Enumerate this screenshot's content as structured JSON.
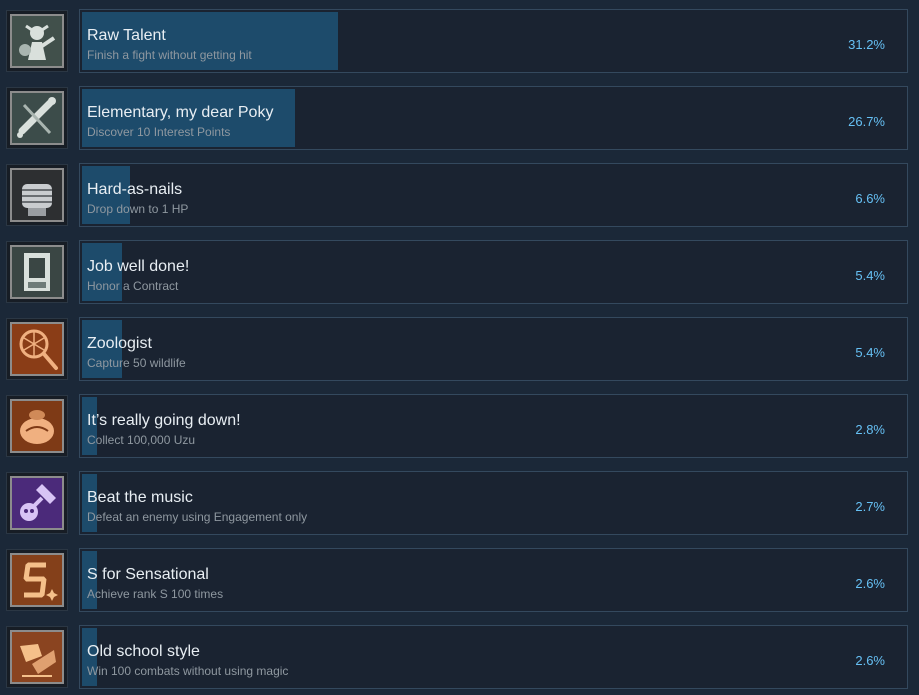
{
  "achievements": [
    {
      "name": "Raw Talent",
      "description": "Finish a fight without getting hit",
      "percent": "31.2%",
      "percent_value": 31.2,
      "icon": "fighter-icon",
      "colors": {
        "bg": "#41504b",
        "fg": "#d9e0dc"
      }
    },
    {
      "name": "Elementary, my dear Poky",
      "description": "Discover 10 Interest Points",
      "percent": "26.7%",
      "percent_value": 26.7,
      "icon": "telescope-icon",
      "colors": {
        "bg": "#3c4c4a",
        "fg": "#d9e0dc"
      }
    },
    {
      "name": "Hard-as-nails",
      "description": "Drop down to 1 HP",
      "percent": "6.6%",
      "percent_value": 6.6,
      "icon": "bandaged-fist-icon",
      "colors": {
        "bg": "#2d2f31",
        "fg": "#c9cccf"
      }
    },
    {
      "name": "Job well done!",
      "description": "Honor a Contract",
      "percent": "5.4%",
      "percent_value": 5.4,
      "icon": "contract-icon",
      "colors": {
        "bg": "#3a4644",
        "fg": "#d9e0dc"
      }
    },
    {
      "name": "Zoologist",
      "description": "Capture 50 wildlife",
      "percent": "5.4%",
      "percent_value": 5.4,
      "icon": "net-icon",
      "colors": {
        "bg": "#8a3d17",
        "fg": "#f0b080"
      }
    },
    {
      "name": "It’s really going down!",
      "description": "Collect 100,000 Uzu",
      "percent": "2.8%",
      "percent_value": 2.8,
      "icon": "money-bag-icon",
      "colors": {
        "bg": "#7e3a16",
        "fg": "#f0b080"
      }
    },
    {
      "name": "Beat the music",
      "description": "Defeat an enemy using Engagement only",
      "percent": "2.7%",
      "percent_value": 2.7,
      "icon": "hammer-skull-icon",
      "colors": {
        "bg": "#4b2a7a",
        "fg": "#d8c4f5"
      }
    },
    {
      "name": "S for Sensational",
      "description": "Achieve rank S 100 times",
      "percent": "2.6%",
      "percent_value": 2.6,
      "icon": "rank-s-icon",
      "colors": {
        "bg": "#84401a",
        "fg": "#f5c08a"
      }
    },
    {
      "name": "Old school style",
      "description": "Win 100 combats without using magic",
      "percent": "2.6%",
      "percent_value": 2.6,
      "icon": "fist-icon",
      "colors": {
        "bg": "#8a4420",
        "fg": "#f5c08a"
      }
    }
  ]
}
